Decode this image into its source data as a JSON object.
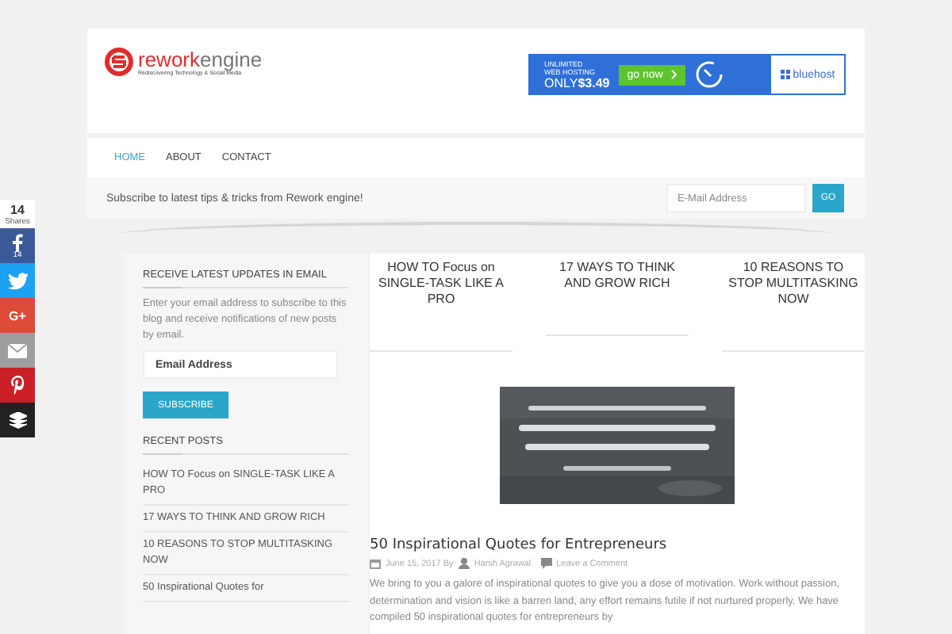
{
  "share_bar": {
    "count": "14",
    "label": "Shares",
    "buttons": [
      {
        "kind": "facebook",
        "count": "14"
      },
      {
        "kind": "twitter"
      },
      {
        "kind": "google",
        "label": "G+"
      },
      {
        "kind": "email"
      },
      {
        "kind": "pinterest"
      },
      {
        "kind": "buffer"
      }
    ]
  },
  "header": {
    "logo": {
      "brand_1": "rework",
      "brand_2": "engine",
      "tagline": "Rediscovering Technology & Social Media"
    },
    "ad": {
      "line_1": "UNLIMITED",
      "line_2": "WEB HOSTING",
      "price_prefix": "ONLY",
      "price": "$3.49",
      "button": "go now",
      "brand": "bluehost"
    }
  },
  "nav": [
    {
      "label": "HOME",
      "selected": true
    },
    {
      "label": "ABOUT",
      "selected": false
    },
    {
      "label": "CONTACT",
      "selected": false
    }
  ],
  "subscribe_bar": {
    "text": "Subscribe to latest tips & tricks from Rework engine!",
    "placeholder": "E-Mail Address",
    "button": "GO"
  },
  "sidebar": {
    "widget_title": "RECEIVE LATEST UPDATES IN EMAIL",
    "description": "Enter your email address to subscribe to this blog and receive notifications of new posts by email.",
    "placeholder": "Email Address",
    "button": "SUBSCRIBE",
    "recent_title": "RECENT POSTS",
    "recent_posts": [
      "HOW TO Focus on SINGLE-TASK LIKE A PRO",
      "17 WAYS TO THINK AND GROW RICH",
      "10 REASONS TO STOP MULTITASKING NOW",
      "50 Inspirational Quotes for"
    ]
  },
  "related_posts": [
    "HOW TO Focus on SINGLE-TASK LIKE A PRO",
    "17 WAYS TO THINK AND GROW RICH",
    "10 REASONS TO STOP MULTITASKING NOW"
  ],
  "article": {
    "title": "50 Inspirational Quotes for Entrepreneurs",
    "date": "June 15, 2017 By",
    "author": "Harsh Agrawal",
    "comments": "Leave a Comment",
    "excerpt": "We bring to you a galore of inspirational quotes to give you a dose of motivation. Work without passion, determination and vision is like a barren land, any effort remains futile if not nurtured properly. We have compiled 50 inspirational quotes for entrepreneurs by"
  }
}
